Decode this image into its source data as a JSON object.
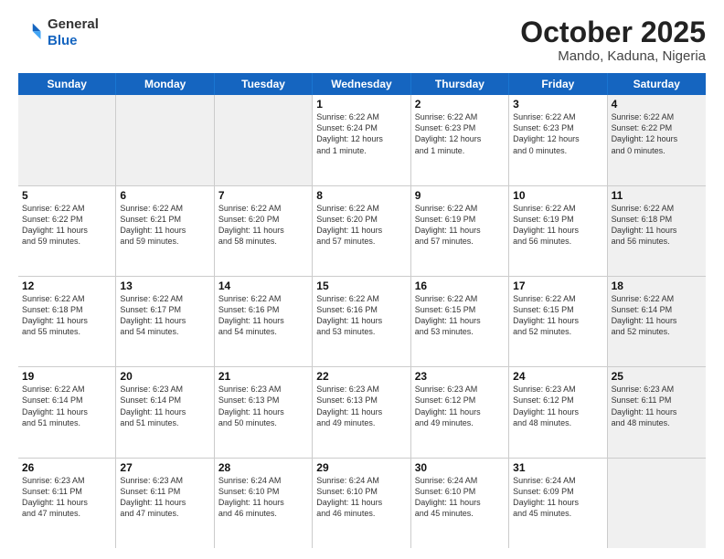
{
  "header": {
    "logo_general": "General",
    "logo_blue": "Blue",
    "title": "October 2025",
    "subtitle": "Mando, Kaduna, Nigeria"
  },
  "days_of_week": [
    "Sunday",
    "Monday",
    "Tuesday",
    "Wednesday",
    "Thursday",
    "Friday",
    "Saturday"
  ],
  "weeks": [
    [
      {
        "day": "",
        "info": "",
        "shaded": true
      },
      {
        "day": "",
        "info": "",
        "shaded": true
      },
      {
        "day": "",
        "info": "",
        "shaded": true
      },
      {
        "day": "1",
        "info": "Sunrise: 6:22 AM\nSunset: 6:24 PM\nDaylight: 12 hours\nand 1 minute.",
        "shaded": false
      },
      {
        "day": "2",
        "info": "Sunrise: 6:22 AM\nSunset: 6:23 PM\nDaylight: 12 hours\nand 1 minute.",
        "shaded": false
      },
      {
        "day": "3",
        "info": "Sunrise: 6:22 AM\nSunset: 6:23 PM\nDaylight: 12 hours\nand 0 minutes.",
        "shaded": false
      },
      {
        "day": "4",
        "info": "Sunrise: 6:22 AM\nSunset: 6:22 PM\nDaylight: 12 hours\nand 0 minutes.",
        "shaded": true
      }
    ],
    [
      {
        "day": "5",
        "info": "Sunrise: 6:22 AM\nSunset: 6:22 PM\nDaylight: 11 hours\nand 59 minutes.",
        "shaded": false
      },
      {
        "day": "6",
        "info": "Sunrise: 6:22 AM\nSunset: 6:21 PM\nDaylight: 11 hours\nand 59 minutes.",
        "shaded": false
      },
      {
        "day": "7",
        "info": "Sunrise: 6:22 AM\nSunset: 6:20 PM\nDaylight: 11 hours\nand 58 minutes.",
        "shaded": false
      },
      {
        "day": "8",
        "info": "Sunrise: 6:22 AM\nSunset: 6:20 PM\nDaylight: 11 hours\nand 57 minutes.",
        "shaded": false
      },
      {
        "day": "9",
        "info": "Sunrise: 6:22 AM\nSunset: 6:19 PM\nDaylight: 11 hours\nand 57 minutes.",
        "shaded": false
      },
      {
        "day": "10",
        "info": "Sunrise: 6:22 AM\nSunset: 6:19 PM\nDaylight: 11 hours\nand 56 minutes.",
        "shaded": false
      },
      {
        "day": "11",
        "info": "Sunrise: 6:22 AM\nSunset: 6:18 PM\nDaylight: 11 hours\nand 56 minutes.",
        "shaded": true
      }
    ],
    [
      {
        "day": "12",
        "info": "Sunrise: 6:22 AM\nSunset: 6:18 PM\nDaylight: 11 hours\nand 55 minutes.",
        "shaded": false
      },
      {
        "day": "13",
        "info": "Sunrise: 6:22 AM\nSunset: 6:17 PM\nDaylight: 11 hours\nand 54 minutes.",
        "shaded": false
      },
      {
        "day": "14",
        "info": "Sunrise: 6:22 AM\nSunset: 6:16 PM\nDaylight: 11 hours\nand 54 minutes.",
        "shaded": false
      },
      {
        "day": "15",
        "info": "Sunrise: 6:22 AM\nSunset: 6:16 PM\nDaylight: 11 hours\nand 53 minutes.",
        "shaded": false
      },
      {
        "day": "16",
        "info": "Sunrise: 6:22 AM\nSunset: 6:15 PM\nDaylight: 11 hours\nand 53 minutes.",
        "shaded": false
      },
      {
        "day": "17",
        "info": "Sunrise: 6:22 AM\nSunset: 6:15 PM\nDaylight: 11 hours\nand 52 minutes.",
        "shaded": false
      },
      {
        "day": "18",
        "info": "Sunrise: 6:22 AM\nSunset: 6:14 PM\nDaylight: 11 hours\nand 52 minutes.",
        "shaded": true
      }
    ],
    [
      {
        "day": "19",
        "info": "Sunrise: 6:22 AM\nSunset: 6:14 PM\nDaylight: 11 hours\nand 51 minutes.",
        "shaded": false
      },
      {
        "day": "20",
        "info": "Sunrise: 6:23 AM\nSunset: 6:14 PM\nDaylight: 11 hours\nand 51 minutes.",
        "shaded": false
      },
      {
        "day": "21",
        "info": "Sunrise: 6:23 AM\nSunset: 6:13 PM\nDaylight: 11 hours\nand 50 minutes.",
        "shaded": false
      },
      {
        "day": "22",
        "info": "Sunrise: 6:23 AM\nSunset: 6:13 PM\nDaylight: 11 hours\nand 49 minutes.",
        "shaded": false
      },
      {
        "day": "23",
        "info": "Sunrise: 6:23 AM\nSunset: 6:12 PM\nDaylight: 11 hours\nand 49 minutes.",
        "shaded": false
      },
      {
        "day": "24",
        "info": "Sunrise: 6:23 AM\nSunset: 6:12 PM\nDaylight: 11 hours\nand 48 minutes.",
        "shaded": false
      },
      {
        "day": "25",
        "info": "Sunrise: 6:23 AM\nSunset: 6:11 PM\nDaylight: 11 hours\nand 48 minutes.",
        "shaded": true
      }
    ],
    [
      {
        "day": "26",
        "info": "Sunrise: 6:23 AM\nSunset: 6:11 PM\nDaylight: 11 hours\nand 47 minutes.",
        "shaded": false
      },
      {
        "day": "27",
        "info": "Sunrise: 6:23 AM\nSunset: 6:11 PM\nDaylight: 11 hours\nand 47 minutes.",
        "shaded": false
      },
      {
        "day": "28",
        "info": "Sunrise: 6:24 AM\nSunset: 6:10 PM\nDaylight: 11 hours\nand 46 minutes.",
        "shaded": false
      },
      {
        "day": "29",
        "info": "Sunrise: 6:24 AM\nSunset: 6:10 PM\nDaylight: 11 hours\nand 46 minutes.",
        "shaded": false
      },
      {
        "day": "30",
        "info": "Sunrise: 6:24 AM\nSunset: 6:10 PM\nDaylight: 11 hours\nand 45 minutes.",
        "shaded": false
      },
      {
        "day": "31",
        "info": "Sunrise: 6:24 AM\nSunset: 6:09 PM\nDaylight: 11 hours\nand 45 minutes.",
        "shaded": false
      },
      {
        "day": "",
        "info": "",
        "shaded": true
      }
    ]
  ]
}
